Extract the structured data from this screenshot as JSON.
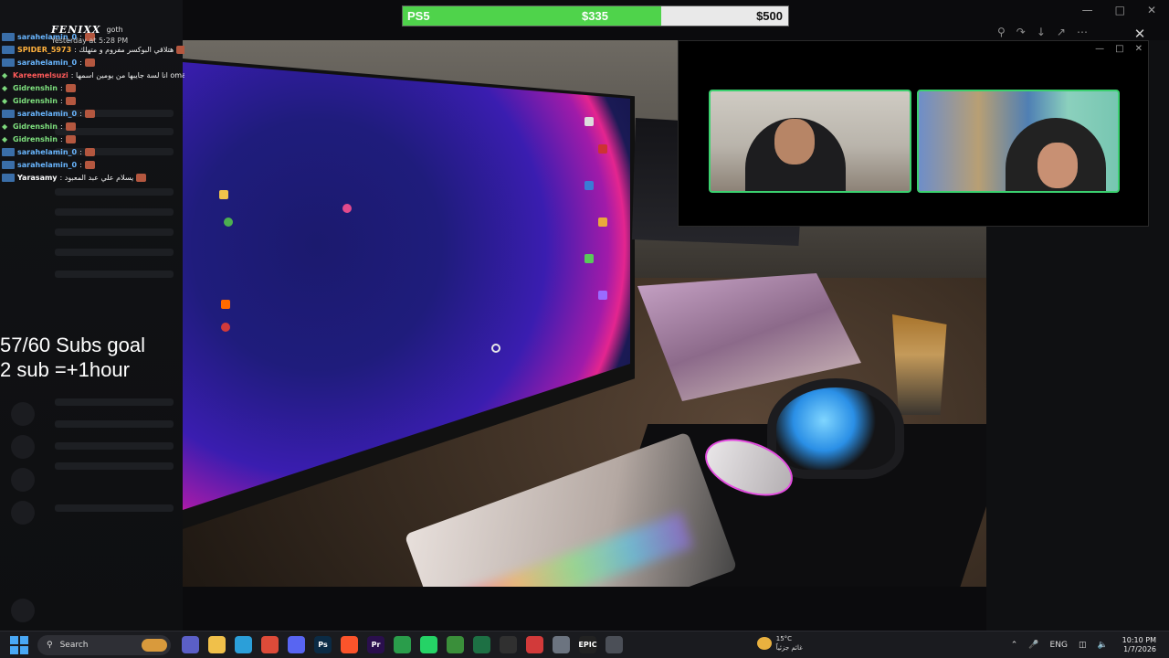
{
  "goal_bar": {
    "item": "PS5",
    "current": "$335",
    "target": "$500",
    "progress": 0.67,
    "fill_color": "#4fd34b"
  },
  "chat": {
    "channel": "FENIXX",
    "tag": "goth",
    "timestamp": "Yesterday at 5:28 PM",
    "messages": [
      {
        "user": "sarahelamin_0",
        "text": ":",
        "color": "#69b6ff",
        "badge": "sub"
      },
      {
        "user": "SPIDER_5973",
        "text": ": هتلاقي البوكسر مفروم و متهلك",
        "color": "#ffb13d",
        "badge": "sub"
      },
      {
        "user": "sarahelamin_0",
        "text": ":",
        "color": "#69b6ff",
        "badge": "sub"
      },
      {
        "user": "Kareemelsuzi",
        "text": ": انا لسة جايبها من يومين اسمها omal ب ١٥٠",
        "color": "#ff5a5a",
        "badge": "diamond"
      },
      {
        "user": "Gidrenshin",
        "text": ":",
        "color": "#7ee07e",
        "badge": "diamond"
      },
      {
        "user": "Gidrenshin",
        "text": ":",
        "color": "#7ee07e",
        "badge": "diamond"
      },
      {
        "user": "sarahelamin_0",
        "text": ":",
        "color": "#69b6ff",
        "badge": "sub"
      },
      {
        "user": "Gidrenshin",
        "text": ":",
        "color": "#7ee07e",
        "badge": "diamond"
      },
      {
        "user": "Gidrenshin",
        "text": ":",
        "color": "#7ee07e",
        "badge": "diamond"
      },
      {
        "user": "sarahelamin_0",
        "text": ":",
        "color": "#69b6ff",
        "badge": "sub"
      },
      {
        "user": "sarahelamin_0",
        "text": ":",
        "color": "#69b6ff",
        "badge": "sub"
      },
      {
        "user": "Yarasamy",
        "text": ": يسلام علي عبد المعبود",
        "color": "#ffffff",
        "badge": "sub"
      }
    ]
  },
  "subs_goal": {
    "line1": "57/60 Subs goal",
    "line2": "2 sub =+1hour"
  },
  "overlay_window": {
    "controls": [
      "minimize-icon",
      "maximize-icon",
      "close-icon"
    ],
    "border_color": "#3bd16f"
  },
  "viewer_toolbar": [
    "zoom-icon",
    "share-icon",
    "download-icon",
    "open-external-icon",
    "more-icon"
  ],
  "taskbar": {
    "search_placeholder": "Search",
    "apps": [
      {
        "icon": "teams-icon",
        "label": "",
        "color": "#5b5fc7"
      },
      {
        "icon": "file-explorer-icon",
        "label": "",
        "color": "#f0c04a"
      },
      {
        "icon": "edge-icon",
        "label": "",
        "color": "#2b9fd9"
      },
      {
        "icon": "chrome-icon",
        "label": "",
        "color": "#dd4b39"
      },
      {
        "icon": "discord-icon",
        "label": "",
        "color": "#5865f2"
      },
      {
        "icon": "photoshop-icon",
        "label": "Ps",
        "color": "#0b2b45"
      },
      {
        "icon": "brave-icon",
        "label": "",
        "color": "#fb542b"
      },
      {
        "icon": "premiere-icon",
        "label": "Pr",
        "color": "#2a0f4d"
      },
      {
        "icon": "xbox-icon",
        "label": "",
        "color": "#2a9d4b"
      },
      {
        "icon": "whatsapp-icon",
        "label": "",
        "color": "#25d366"
      },
      {
        "icon": "minecraft-icon",
        "label": "",
        "color": "#3a8f3a"
      },
      {
        "icon": "excel-icon",
        "label": "",
        "color": "#1d7044"
      },
      {
        "icon": "obs-icon",
        "label": "",
        "color": "#303030"
      },
      {
        "icon": "streaming-app-icon",
        "label": "",
        "color": "#d23a3a"
      },
      {
        "icon": "settings-icon",
        "label": "",
        "color": "#6c7480"
      },
      {
        "icon": "epic-games-icon",
        "label": "EPIC",
        "color": "#222222"
      },
      {
        "icon": "calculator-icon",
        "label": "",
        "color": "#4b4f57"
      }
    ],
    "weather_temp": "15°C",
    "weather_desc": "غائم جزئياً",
    "language": "ENG",
    "time": "10:10 PM",
    "date": "1/7/2026"
  }
}
